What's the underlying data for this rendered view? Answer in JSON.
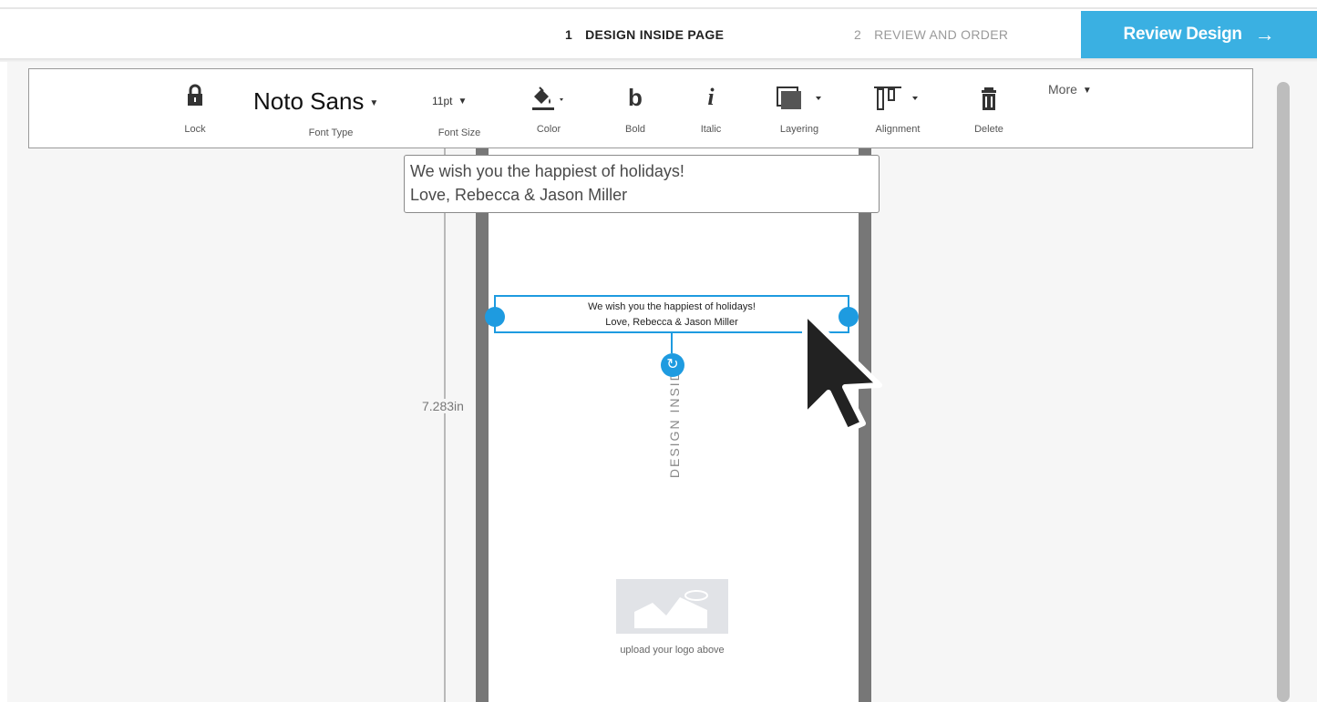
{
  "steps": {
    "step1": {
      "num": "1",
      "label": "DESIGN INSIDE PAGE"
    },
    "step2": {
      "num": "2",
      "label": "REVIEW AND ORDER"
    },
    "review_button": {
      "label": "Review Design",
      "arrow": "→"
    }
  },
  "toolbar": {
    "lock": {
      "icon": "lock-icon",
      "label": "Lock"
    },
    "font_type": {
      "value": "Noto Sans",
      "label": "Font Type"
    },
    "font_size": {
      "value": "11pt",
      "label": "Font Size"
    },
    "color": {
      "icon": "paint-bucket-icon",
      "label": "Color"
    },
    "bold": {
      "icon": "bold-icon",
      "glyph": "b",
      "label": "Bold"
    },
    "italic": {
      "icon": "italic-icon",
      "glyph": "i",
      "label": "Italic"
    },
    "layering": {
      "icon": "layers-icon",
      "label": "Layering"
    },
    "alignment": {
      "icon": "align-top-icon",
      "label": "Alignment"
    },
    "delete": {
      "icon": "trash-icon",
      "label": "Delete"
    },
    "more": {
      "label": "More"
    }
  },
  "editor": {
    "line1": "We wish you the happiest of holidays!",
    "line2": "Love, Rebecca & Jason Miller"
  },
  "canvas": {
    "text_line1": "We wish you the happiest of holidays!",
    "text_line2": "Love, Rebecca & Jason Miller",
    "ruler_label": "7.283in",
    "vertical_watermark": "DESIGN INSIDE",
    "logo_caption": "upload your logo above"
  },
  "colors": {
    "accent": "#3ab0e2",
    "selection": "#1e9be0",
    "page_border": "#777777"
  }
}
